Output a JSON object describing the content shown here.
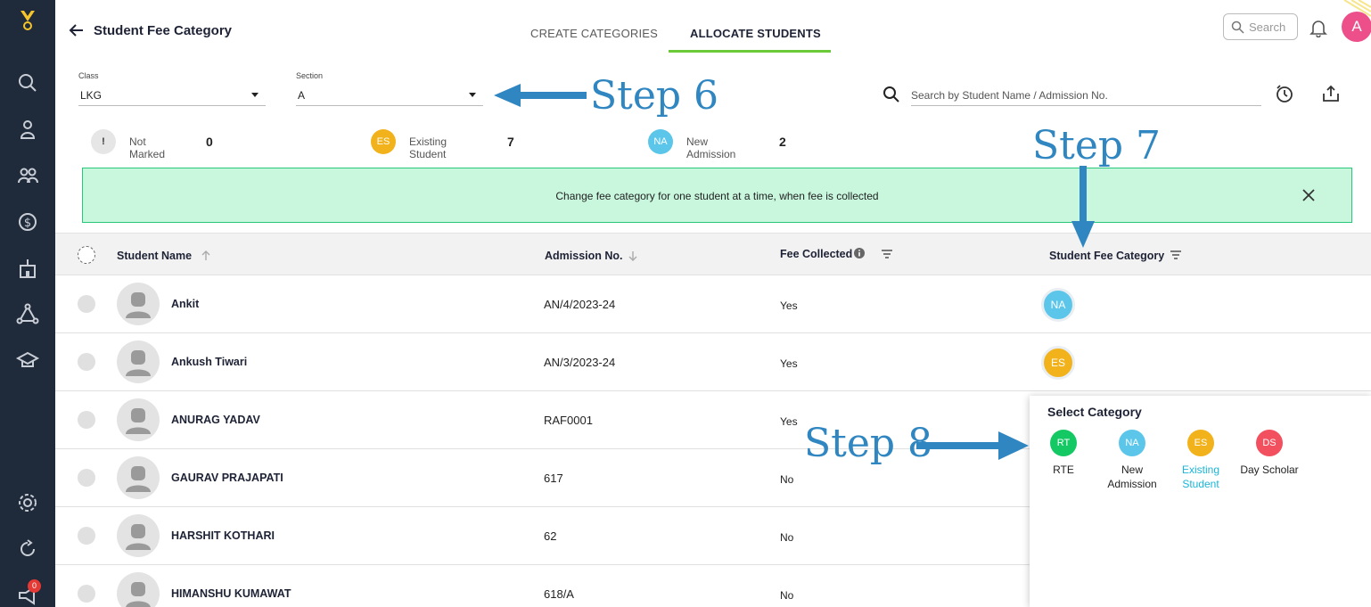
{
  "header": {
    "page_title": "Student Fee Category",
    "tabs": [
      {
        "label": "CREATE CATEGORIES",
        "active": false
      },
      {
        "label": "ALLOCATE STUDENTS",
        "active": true
      }
    ],
    "search_placeholder": "Search",
    "avatar_initial": "A"
  },
  "sidebar": {
    "items": [
      "search-icon",
      "student-icon",
      "people-icon",
      "dollar-icon",
      "building-icon",
      "network-icon",
      "graduation-icon",
      "settings-icon",
      "refresh-icon",
      "megaphone-icon"
    ],
    "notification_count": "0"
  },
  "filters": {
    "class_label": "Class",
    "class_value": "LKG",
    "section_label": "Section",
    "section_value": "A",
    "student_search_placeholder": "Search by Student Name / Admission No."
  },
  "summary": [
    {
      "badge": "!",
      "label": "Not Marked",
      "count": "0",
      "color": "#e6e6e6"
    },
    {
      "badge": "ES",
      "label": "Existing Student",
      "count": "7",
      "color": "#f2b21b"
    },
    {
      "badge": "NA",
      "label": "New Admission",
      "count": "2",
      "color": "#5bc6ea"
    }
  ],
  "banner": {
    "message": "Change fee category for one student at a time, when fee is collected"
  },
  "table": {
    "columns": [
      "Student Name",
      "Admission No.",
      "Fee Collected",
      "Student Fee Category"
    ],
    "rows": [
      {
        "name": "Ankit",
        "admission": "AN/4/2023-24",
        "fee": "Yes",
        "category": "NA"
      },
      {
        "name": "Ankush Tiwari",
        "admission": "AN/3/2023-24",
        "fee": "Yes",
        "category": "ES"
      },
      {
        "name": "ANURAG YADAV",
        "admission": "RAF0001",
        "fee": "Yes",
        "category": ""
      },
      {
        "name": "GAURAV PRAJAPATI",
        "admission": "617",
        "fee": "No",
        "category": ""
      },
      {
        "name": "HARSHIT KOTHARI",
        "admission": "62",
        "fee": "No",
        "category": ""
      },
      {
        "name": "HIMANSHU KUMAWAT",
        "admission": "618/A",
        "fee": "No",
        "category": ""
      }
    ]
  },
  "popup": {
    "title": "Select Category",
    "options": [
      {
        "code": "RT",
        "label": "RTE",
        "color": "#14c964"
      },
      {
        "code": "NA",
        "label": "New Admission",
        "color": "#5bc6ea"
      },
      {
        "code": "ES",
        "label": "Existing Student",
        "color": "#f2b21b",
        "active": true
      },
      {
        "code": "DS",
        "label": "Day Scholar",
        "color": "#f2505e"
      }
    ]
  },
  "annotations": {
    "step6": "Step 6",
    "step7": "Step 7",
    "step8": "Step 8"
  },
  "colors": {
    "sidebar": "#1f2a3a",
    "accent_tab": "#6cc93a",
    "banner_bg": "#c8f7de",
    "annotation": "#2f86c0"
  }
}
